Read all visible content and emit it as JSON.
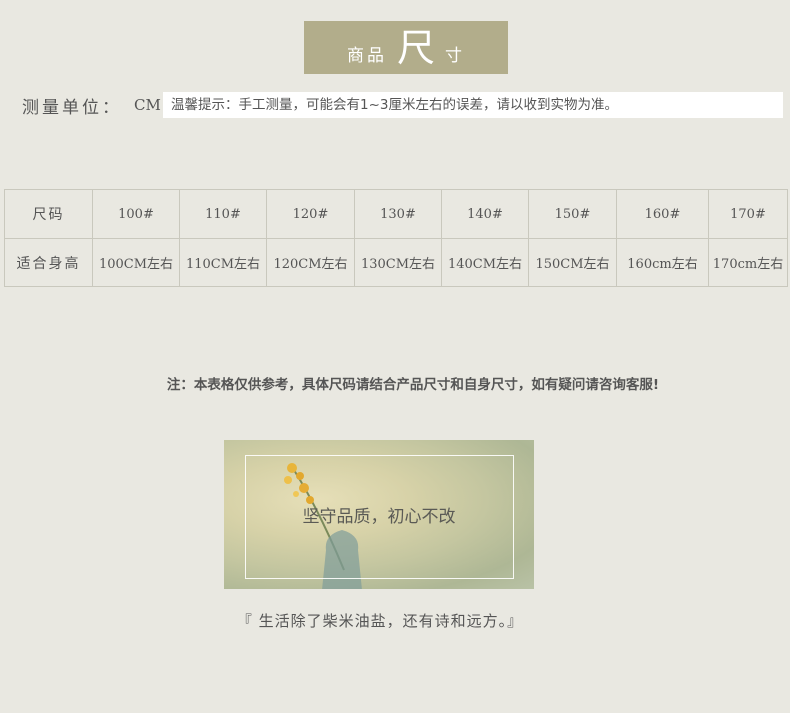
{
  "title": {
    "left": "商品",
    "big": "尺",
    "right": "寸"
  },
  "unit": {
    "label": "测量单位：",
    "value": "CM"
  },
  "tip": "温馨提示：手工测量，可能会有1~3厘米左右的误差，请以收到实物为准。",
  "table": {
    "row1_header": "尺码",
    "row2_header": "适合身高",
    "sizes": [
      "100#",
      "110#",
      "120#",
      "130#",
      "140#",
      "150#",
      "160#",
      "170#"
    ],
    "heights": [
      "100CM左右",
      "110CM左右",
      "120CM左右",
      "130CM左右",
      "140CM左右",
      "150CM左右",
      "160cm左右",
      "170cm左右"
    ]
  },
  "note": "注：本表格仅供参考，具体尺码请结合产品尺寸和自身尺寸，如有疑问请咨询客服!",
  "photo": {
    "slogan": "坚守品质，初心不改"
  },
  "quote": "『 生活除了柴米油盐，还有诗和远方。』"
}
